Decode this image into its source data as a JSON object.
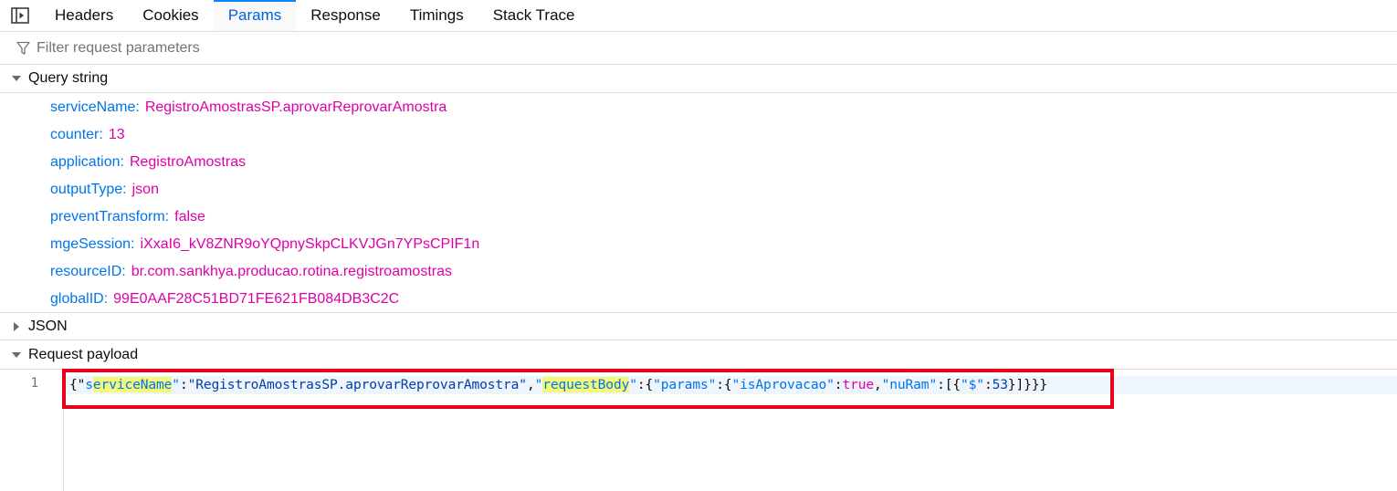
{
  "tabs": [
    {
      "label": "Headers",
      "selected": false
    },
    {
      "label": "Cookies",
      "selected": false
    },
    {
      "label": "Params",
      "selected": true
    },
    {
      "label": "Response",
      "selected": false
    },
    {
      "label": "Timings",
      "selected": false
    },
    {
      "label": "Stack Trace",
      "selected": false
    }
  ],
  "filter": {
    "placeholder": "Filter request parameters",
    "value": ""
  },
  "sections": {
    "query_string": "Query string",
    "json": "JSON",
    "payload": "Request payload"
  },
  "query_params": [
    {
      "key": "serviceName",
      "value": "RegistroAmostrasSP.aprovarReprovarAmostra"
    },
    {
      "key": "counter",
      "value": "13"
    },
    {
      "key": "application",
      "value": "RegistroAmostras"
    },
    {
      "key": "outputType",
      "value": "json"
    },
    {
      "key": "preventTransform",
      "value": "false"
    },
    {
      "key": "mgeSession",
      "value": "iXxaI6_kV8ZNR9oYQpnySkpCLKVJGn7YPsCPIF1n"
    },
    {
      "key": "resourceID",
      "value": "br.com.sankhya.producao.rotina.registroamostras"
    },
    {
      "key": "globalID",
      "value": "99E0AAF28C51BD71FE621FB084DB3C2C"
    }
  ],
  "payload": {
    "line_number": "1",
    "tokens": {
      "t0": "{\"",
      "t1": "s",
      "t2": "erviceName",
      "t3": "\"",
      "t4": ":",
      "t5": "\"RegistroAmostrasSP.aprovarReprovarAmostra\"",
      "t6": ",",
      "t7": "\"",
      "t8": "requestBody",
      "t9": "\"",
      "t10": ":{",
      "t11": "\"params\"",
      "t12": ":{",
      "t13": "\"isAprovacao\"",
      "t14": ":",
      "t15": "true",
      "t16": ",",
      "t17": "\"nuRam\"",
      "t18": ":[{",
      "t19": "\"$\"",
      "t20": ":",
      "t21": "53",
      "t22": "}]}}}"
    }
  },
  "colors": {
    "accent": "#0a84ff",
    "key": "#0074e8",
    "value": "#dd00a9",
    "highlight": "#f4f97a",
    "annotation_box": "#e8001c"
  }
}
